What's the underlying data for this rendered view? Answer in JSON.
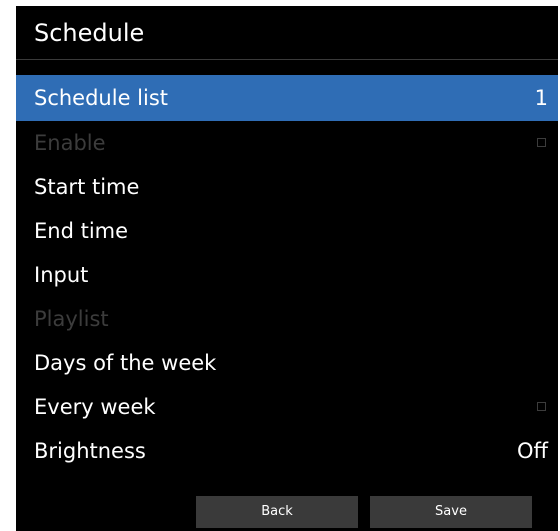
{
  "title": "Schedule",
  "menu": {
    "schedule_list": {
      "label": "Schedule list",
      "value": "1"
    },
    "enable": {
      "label": "Enable"
    },
    "start_time": {
      "label": "Start time"
    },
    "end_time": {
      "label": "End time"
    },
    "input": {
      "label": "Input"
    },
    "playlist": {
      "label": "Playlist"
    },
    "days_of_week": {
      "label": "Days of the week"
    },
    "every_week": {
      "label": "Every week"
    },
    "brightness": {
      "label": "Brightness",
      "value": "Off"
    }
  },
  "buttons": {
    "back": "Back",
    "save": "Save"
  },
  "colors": {
    "background": "#000000",
    "selection": "#2f6db5",
    "disabled_text": "#3c3c3c",
    "button": "#3a3a3a"
  },
  "icons": {
    "enable_checkbox": "checkbox-unchecked-icon",
    "every_week_checkbox": "checkbox-unchecked-icon"
  }
}
